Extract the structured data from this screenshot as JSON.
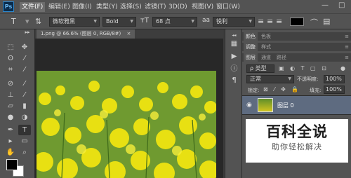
{
  "menubar": {
    "logo": "Ps",
    "items": [
      "文件(F)",
      "编辑(E)",
      "图像(I)",
      "类型(Y)",
      "选择(S)",
      "滤镜(T)",
      "3D(D)",
      "视图(V)",
      "窗口(W)"
    ],
    "min": "—",
    "max": "□"
  },
  "options": {
    "font_family": "微软雅黑",
    "font_style": "Bold",
    "font_size": "68 点",
    "antialias": "锐利"
  },
  "document": {
    "tab_title": "1.png @ 66.6% (图层 0, RGB/8#)",
    "tab_close": "×"
  },
  "panels": {
    "row1": [
      "颜色",
      "色板"
    ],
    "row2": [
      "调整",
      "样式"
    ],
    "row3": [
      "图层",
      "通道",
      "路径"
    ],
    "filter_label": "ρ 类型",
    "blend_mode": "正常",
    "opacity_label": "不透明度:",
    "opacity_value": "100%",
    "lock_label": "锁定:",
    "fill_label": "填充:",
    "fill_value": "100%",
    "layer_name": "图层 0"
  },
  "watermark": {
    "title": "百科全说",
    "subtitle": "助你轻松解决"
  },
  "colors": {
    "foreground": "#000000",
    "background": "#ffffff",
    "layer_selected": "#5e6b80"
  }
}
